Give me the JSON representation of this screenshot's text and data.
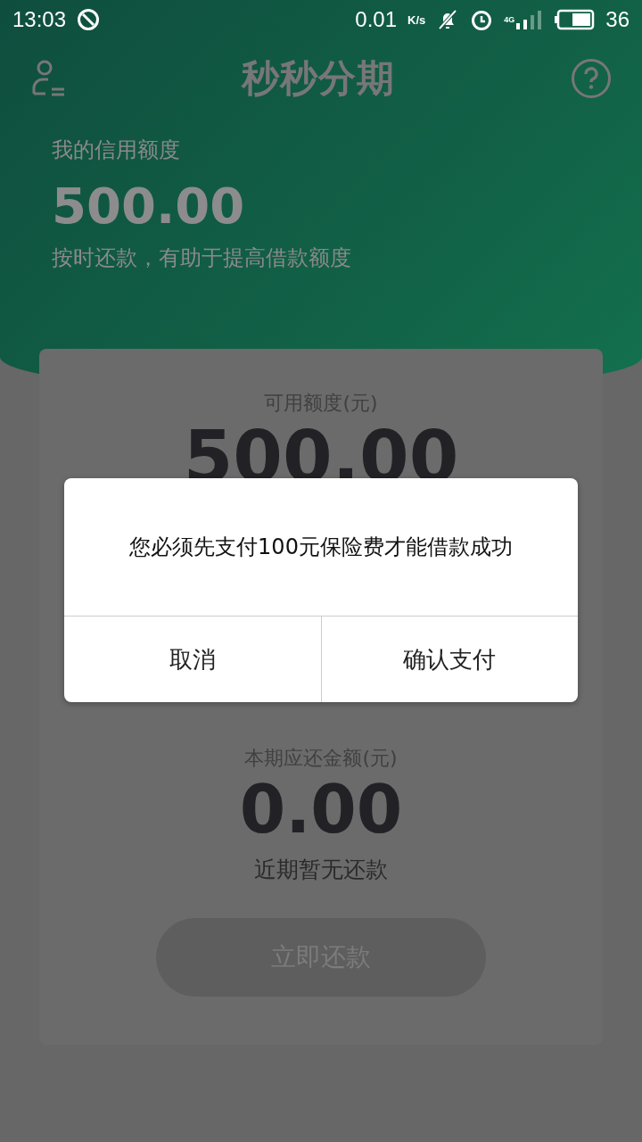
{
  "status_bar": {
    "time": "13:03",
    "speed": "0.01",
    "speed_unit": "K/s",
    "network": "4G",
    "battery": "36"
  },
  "header": {
    "title": "秒秒分期"
  },
  "credit": {
    "label": "我的信用额度",
    "amount": "500.00",
    "hint": "按时还款，有助于提高借款额度"
  },
  "available": {
    "label": "可用额度(元)",
    "amount": "500.00"
  },
  "repayment": {
    "label": "本期应还金额(元)",
    "amount": "0.00",
    "note": "近期暂无还款",
    "button": {
      "label": "立即还款",
      "disabled": true
    }
  },
  "dialog": {
    "message": "您必须先支付100元保险费才能借款成功",
    "buttons": [
      {
        "label": "取消",
        "kind": "cancel"
      },
      {
        "label": "确认支付",
        "kind": "confirm"
      }
    ]
  }
}
